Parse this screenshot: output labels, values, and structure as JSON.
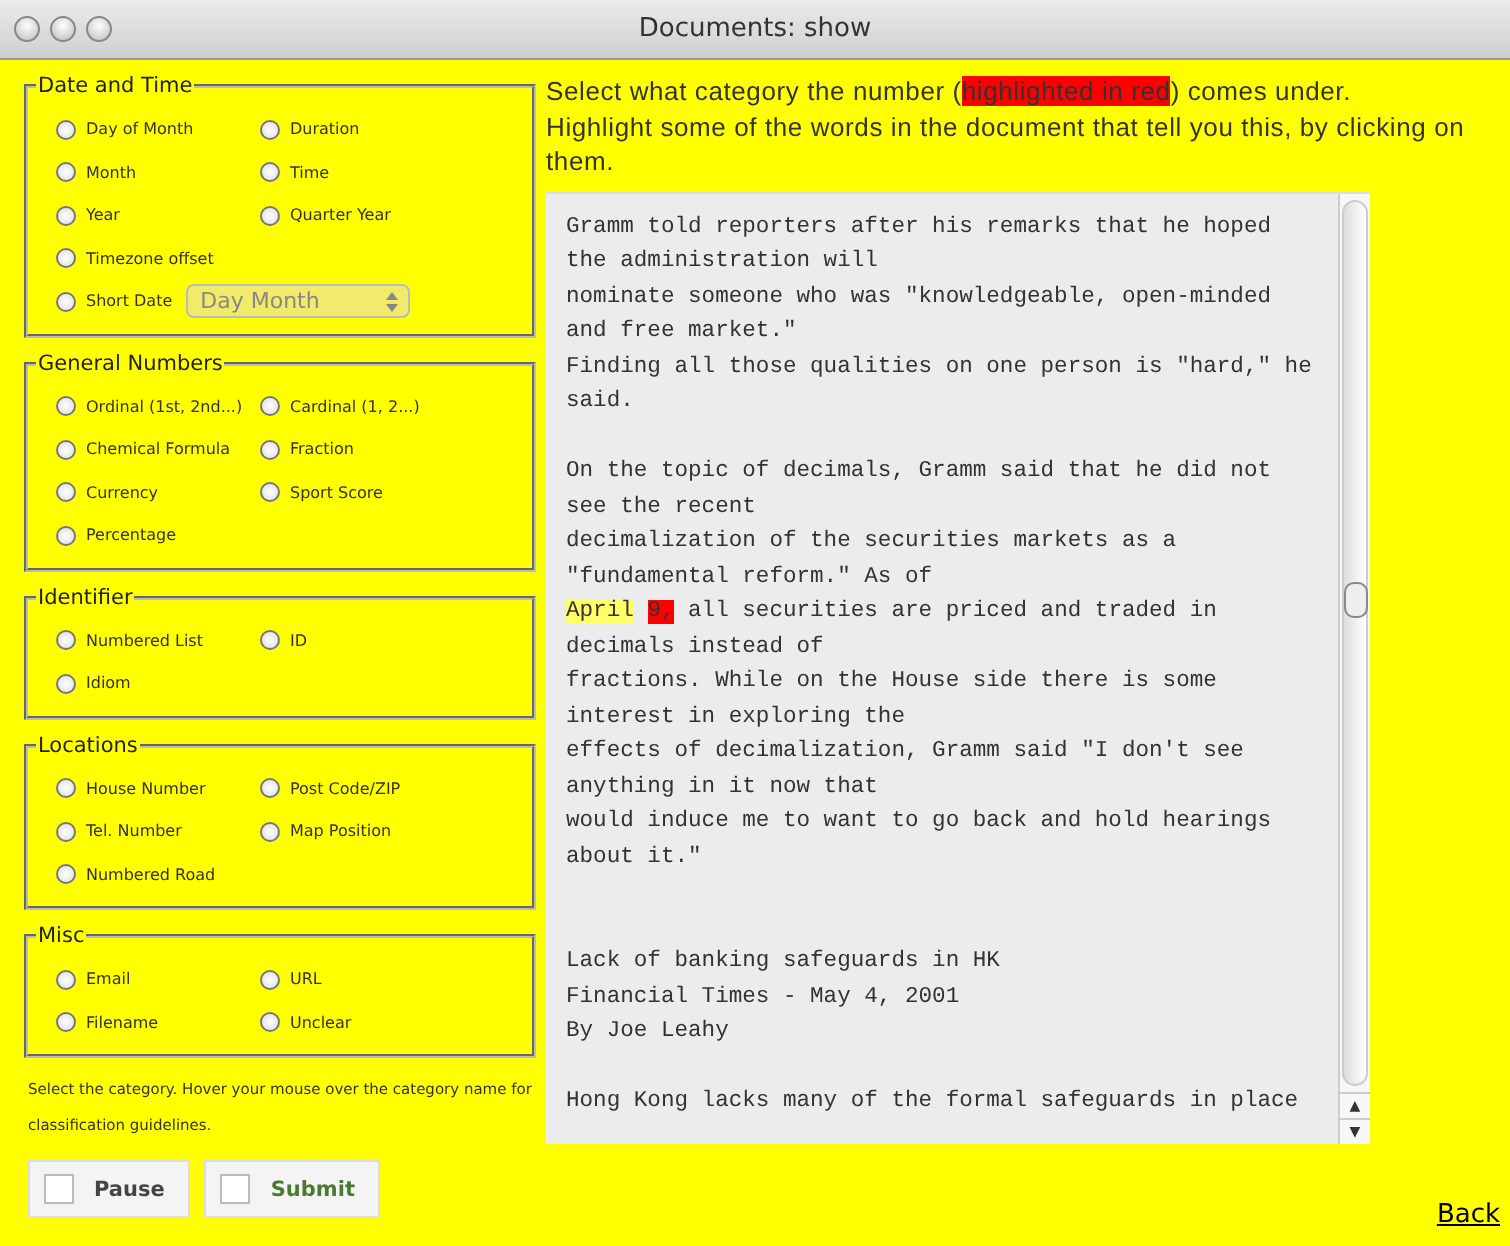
{
  "window": {
    "title": "Documents: show"
  },
  "groups": [
    {
      "title": "Date and Time",
      "options": [
        {
          "label": "Day of Month",
          "selected": false
        },
        {
          "label": "Duration",
          "selected": false
        },
        {
          "label": "Month",
          "selected": false
        },
        {
          "label": "Time",
          "selected": false
        },
        {
          "label": "Year",
          "selected": false
        },
        {
          "label": "Quarter Year",
          "selected": false
        },
        {
          "label": "Timezone offset",
          "selected": false
        },
        {
          "label": "Short Date",
          "selected": false,
          "dropdown": "Day Month"
        }
      ]
    },
    {
      "title": "General Numbers",
      "options": [
        {
          "label": "Ordinal (1st, 2nd...)",
          "selected": false
        },
        {
          "label": "Cardinal (1, 2...)",
          "selected": false
        },
        {
          "label": "Chemical Formula",
          "selected": false
        },
        {
          "label": "Fraction",
          "selected": false
        },
        {
          "label": "Currency",
          "selected": false
        },
        {
          "label": "Sport Score",
          "selected": false
        },
        {
          "label": "Percentage",
          "selected": false
        }
      ]
    },
    {
      "title": "Identifier",
      "options": [
        {
          "label": "Numbered List",
          "selected": false
        },
        {
          "label": "ID",
          "selected": false
        },
        {
          "label": "Idiom",
          "selected": false
        }
      ]
    },
    {
      "title": "Locations",
      "options": [
        {
          "label": "House Number",
          "selected": false
        },
        {
          "label": "Post Code/ZIP",
          "selected": false
        },
        {
          "label": "Tel. Number",
          "selected": false
        },
        {
          "label": "Map Position",
          "selected": false
        },
        {
          "label": "Numbered Road",
          "selected": false
        }
      ]
    },
    {
      "title": "Misc",
      "options": [
        {
          "label": "Email",
          "selected": false
        },
        {
          "label": "URL",
          "selected": false
        },
        {
          "label": "Filename",
          "selected": false
        },
        {
          "label": "Unclear",
          "selected": false
        }
      ]
    }
  ],
  "help_text": "Select the category. Hover your mouse over the category name for classification guidelines.",
  "buttons": [
    {
      "label": "Pause",
      "kind": "plain",
      "checked": false
    },
    {
      "label": "Submit",
      "kind": "primary",
      "checked": false
    }
  ],
  "instruction": [
    {
      "text": "Select what category the number (",
      "target": false
    },
    {
      "text": "highlighted in red",
      "target": true
    },
    {
      "text": ") comes under.",
      "target": false
    }
  ],
  "instruction_2": "Highlight some of the words in the document that tell you this, by clicking on them.",
  "document": [
    {
      "kind": "line",
      "segments": [
        {
          "text": "Gramm told reporters after his remarks that he hoped",
          "highlighted": false,
          "target": false
        }
      ]
    },
    {
      "kind": "line",
      "segments": [
        {
          "text": "the administration will",
          "highlighted": false,
          "target": false
        }
      ]
    },
    {
      "kind": "line",
      "segments": [
        {
          "text": "nominate someone who was \"knowledgeable, open-minded",
          "highlighted": false,
          "target": false
        }
      ]
    },
    {
      "kind": "line",
      "segments": [
        {
          "text": "and free market.\"",
          "highlighted": false,
          "target": false
        }
      ]
    },
    {
      "kind": "line",
      "segments": [
        {
          "text": "Finding all those qualities on one person is \"hard,\" he",
          "highlighted": false,
          "target": false
        }
      ]
    },
    {
      "kind": "line",
      "segments": [
        {
          "text": "said.",
          "highlighted": false,
          "target": false
        }
      ]
    },
    {
      "kind": "blank"
    },
    {
      "kind": "line",
      "segments": [
        {
          "text": "On the topic of decimals, Gramm said that he did not",
          "highlighted": false,
          "target": false
        }
      ]
    },
    {
      "kind": "line",
      "segments": [
        {
          "text": "see the recent",
          "highlighted": false,
          "target": false
        }
      ]
    },
    {
      "kind": "line",
      "segments": [
        {
          "text": "decimalization of the securities markets as a",
          "highlighted": false,
          "target": false
        }
      ]
    },
    {
      "kind": "line",
      "segments": [
        {
          "text": "\"fundamental reform.\" As of",
          "highlighted": false,
          "target": false
        }
      ]
    },
    {
      "kind": "line",
      "segments": [
        {
          "text": "April",
          "highlighted": true,
          "target": false
        },
        {
          "text": "9,",
          "highlighted": false,
          "target": true
        },
        {
          "text": "all securities are priced and traded in",
          "highlighted": false,
          "target": false
        }
      ]
    },
    {
      "kind": "line",
      "segments": [
        {
          "text": "decimals instead of",
          "highlighted": false,
          "target": false
        }
      ]
    },
    {
      "kind": "line",
      "segments": [
        {
          "text": "fractions. While on the House side there is some",
          "highlighted": false,
          "target": false
        }
      ]
    },
    {
      "kind": "line",
      "segments": [
        {
          "text": "interest in exploring the",
          "highlighted": false,
          "target": false
        }
      ]
    },
    {
      "kind": "line",
      "segments": [
        {
          "text": "effects of decimalization, Gramm said \"I don't see",
          "highlighted": false,
          "target": false
        }
      ]
    },
    {
      "kind": "line",
      "segments": [
        {
          "text": "anything in it now that",
          "highlighted": false,
          "target": false
        }
      ]
    },
    {
      "kind": "line",
      "segments": [
        {
          "text": "would induce me to want to go back and hold hearings",
          "highlighted": false,
          "target": false
        }
      ]
    },
    {
      "kind": "line",
      "segments": [
        {
          "text": "about it.\"",
          "highlighted": false,
          "target": false
        }
      ]
    },
    {
      "kind": "blank"
    },
    {
      "kind": "blank"
    },
    {
      "kind": "line",
      "segments": [
        {
          "text": "Lack of banking safeguards in HK",
          "highlighted": false,
          "target": false
        }
      ]
    },
    {
      "kind": "line",
      "segments": [
        {
          "text": "Financial Times - May 4, 2001",
          "highlighted": false,
          "target": false
        }
      ]
    },
    {
      "kind": "line",
      "segments": [
        {
          "text": "By Joe Leahy",
          "highlighted": false,
          "target": false
        }
      ]
    },
    {
      "kind": "blank"
    },
    {
      "kind": "line",
      "segments": [
        {
          "text": "Hong Kong lacks many of the formal safeguards in place",
          "highlighted": false,
          "target": false
        }
      ]
    }
  ],
  "scroll_buttons": [
    "▲",
    "▼"
  ],
  "back_link": "Back"
}
